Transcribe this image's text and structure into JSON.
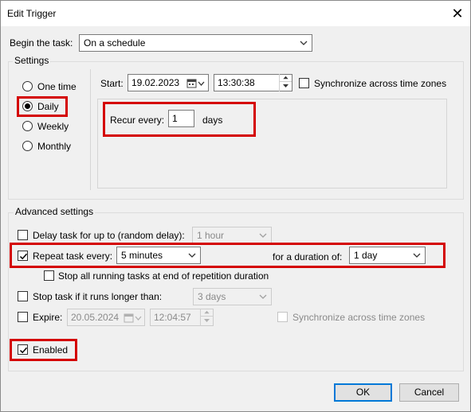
{
  "window": {
    "title": "Edit Trigger",
    "close_glyph": "✕"
  },
  "begin": {
    "label": "Begin the task:",
    "value": "On a schedule"
  },
  "settings": {
    "legend": "Settings",
    "options": [
      {
        "label": "One time",
        "checked": false
      },
      {
        "label": "Daily",
        "checked": true
      },
      {
        "label": "Weekly",
        "checked": false
      },
      {
        "label": "Monthly",
        "checked": false
      }
    ],
    "start_label": "Start:",
    "start_date": "19.02.2023",
    "start_time": "13:30:38",
    "sync_label": "Synchronize across time zones",
    "sync_checked": false,
    "recur_label": "Recur every:",
    "recur_value": "1",
    "recur_unit": "days"
  },
  "advanced": {
    "legend": "Advanced settings",
    "delay_label": "Delay task for up to (random delay):",
    "delay_value": "1 hour",
    "delay_checked": false,
    "repeat_label": "Repeat task every:",
    "repeat_value": "5 minutes",
    "repeat_checked": true,
    "duration_label": "for a duration of:",
    "duration_value": "1 day",
    "stop_running_label": "Stop all running tasks at end of repetition duration",
    "stop_running_checked": false,
    "stop_long_label": "Stop task if it runs longer than:",
    "stop_long_value": "3 days",
    "stop_long_checked": false,
    "expire_label": "Expire:",
    "expire_date": "20.05.2024",
    "expire_time": "12:04:57",
    "expire_checked": false,
    "expire_sync_label": "Synchronize across time zones",
    "enabled_label": "Enabled",
    "enabled_checked": true
  },
  "buttons": {
    "ok": "OK",
    "cancel": "Cancel"
  },
  "colors": {
    "highlight": "#d40000",
    "accent": "#0078d7"
  }
}
